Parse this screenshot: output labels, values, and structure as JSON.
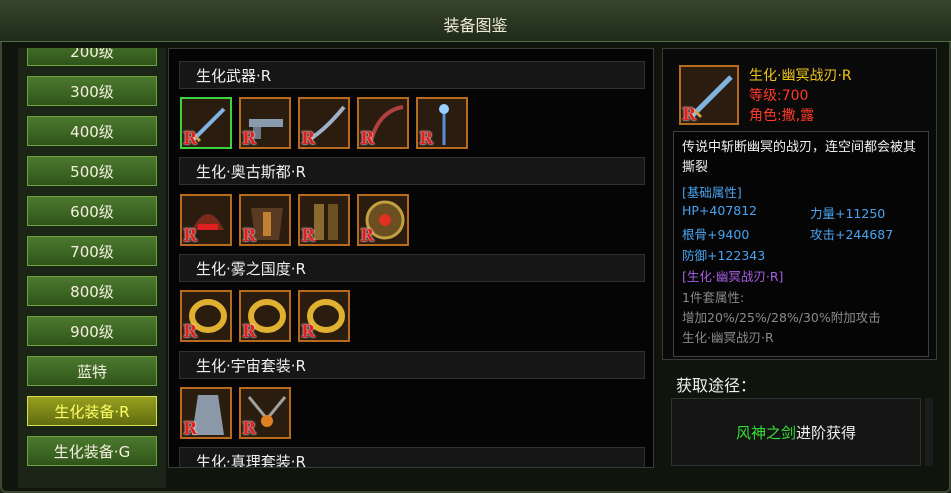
{
  "window": {
    "title": "装备图鉴"
  },
  "menu": {
    "items": [
      {
        "label": "200级",
        "selected": false
      },
      {
        "label": "300级",
        "selected": false
      },
      {
        "label": "400级",
        "selected": false
      },
      {
        "label": "500级",
        "selected": false
      },
      {
        "label": "600级",
        "selected": false
      },
      {
        "label": "700级",
        "selected": false
      },
      {
        "label": "800级",
        "selected": false
      },
      {
        "label": "900级",
        "selected": false
      },
      {
        "label": "蓝特",
        "selected": false
      },
      {
        "label": "生化装备·R",
        "selected": true
      },
      {
        "label": "生化装备·G",
        "selected": false
      }
    ]
  },
  "categories": [
    {
      "title": "生化武器·R",
      "items": [
        "sword-icon",
        "gun-icon",
        "blade-icon",
        "bow-icon",
        "staff-icon"
      ]
    },
    {
      "title": "生化·奥古斯都·R",
      "items": [
        "helmet-icon",
        "armor-icon",
        "greaves-icon",
        "shield-icon"
      ]
    },
    {
      "title": "生化·雾之国度·R",
      "items": [
        "ring-icon",
        "ring-icon",
        "ring-icon"
      ]
    },
    {
      "title": "生化·宇宙套装·R",
      "items": [
        "robe-icon",
        "necklace-icon"
      ]
    },
    {
      "title": "生化·真理套装·R",
      "items": []
    }
  ],
  "rarity_mark": "R",
  "detail": {
    "name": "生化·幽冥战刃·R",
    "level": "等级:700",
    "role": "角色:撒,露",
    "description": "传说中斩断幽冥的战刃，连空间都会被其撕裂",
    "base_attr_header": "[基础属性]",
    "attrs": {
      "hp": "HP+407812",
      "strength": "力量+11250",
      "bone": "根骨+9400",
      "attack": "攻击+244687",
      "defense": "防御+122343"
    },
    "set_name": "[生化·幽冥战刃·R]",
    "set_count": "1件套属性:",
    "set_bonus": "增加20%/25%/28%/30%附加攻击",
    "set_item": "生化·幽冥战刃·R"
  },
  "obtain": {
    "title": "获取途径：",
    "source": "风神之剑",
    "action": "进阶获得"
  },
  "colors": {
    "slot_border": "#b86a1e",
    "selected_border": "#3fd23f",
    "name_gold": "#f0c419",
    "red": "#ff3a2a",
    "blue": "#4aa3f0",
    "purple": "#a75fe5"
  }
}
